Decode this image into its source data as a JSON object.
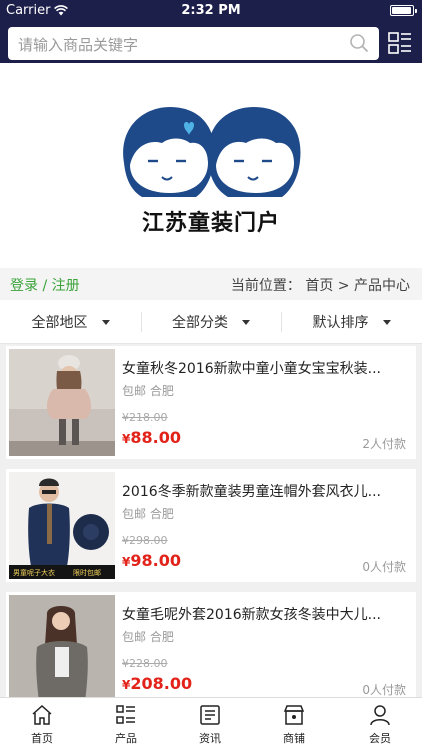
{
  "status_bar": {
    "carrier": "Carrier",
    "time": "2:32 PM"
  },
  "search": {
    "placeholder": "请输入商品关键字"
  },
  "brand": {
    "name": "江苏童装门户"
  },
  "breadcrumb": {
    "login": "登录 / 注册",
    "location": "当前位置： 首页 > 产品中心"
  },
  "filters": [
    {
      "label": "全部地区"
    },
    {
      "label": "全部分类"
    },
    {
      "label": "默认排序"
    }
  ],
  "products": [
    {
      "title": "女童秋冬2016新款中童小童女宝宝秋装...",
      "location": "包邮 合肥",
      "old_price": "¥218.00",
      "yen": "¥",
      "price": "88.00",
      "sold": "2人付款"
    },
    {
      "title": "2016冬季新款童装男童连帽外套风衣儿...",
      "location": "包邮 合肥",
      "old_price": "¥298.00",
      "yen": "¥",
      "price": "98.00",
      "sold": "0人付款",
      "banner_left": "男童呢子大衣",
      "banner_right": "限时包邮"
    },
    {
      "title": "女童毛呢外套2016新款女孩冬装中大儿...",
      "location": "包邮 合肥",
      "old_price": "¥228.00",
      "yen": "¥",
      "price": "208.00",
      "sold": "0人付款"
    }
  ],
  "tabbar": [
    {
      "label": "首页",
      "icon": "home-icon"
    },
    {
      "label": "产品",
      "icon": "list-icon"
    },
    {
      "label": "资讯",
      "icon": "news-icon"
    },
    {
      "label": "商铺",
      "icon": "store-icon"
    },
    {
      "label": "会员",
      "icon": "user-icon"
    }
  ],
  "colors": {
    "header": "#1d1f4b",
    "price": "#e2231a",
    "login": "#3aa33a",
    "logo_blue": "#1f4a8a",
    "heart": "#4fb3e6"
  }
}
